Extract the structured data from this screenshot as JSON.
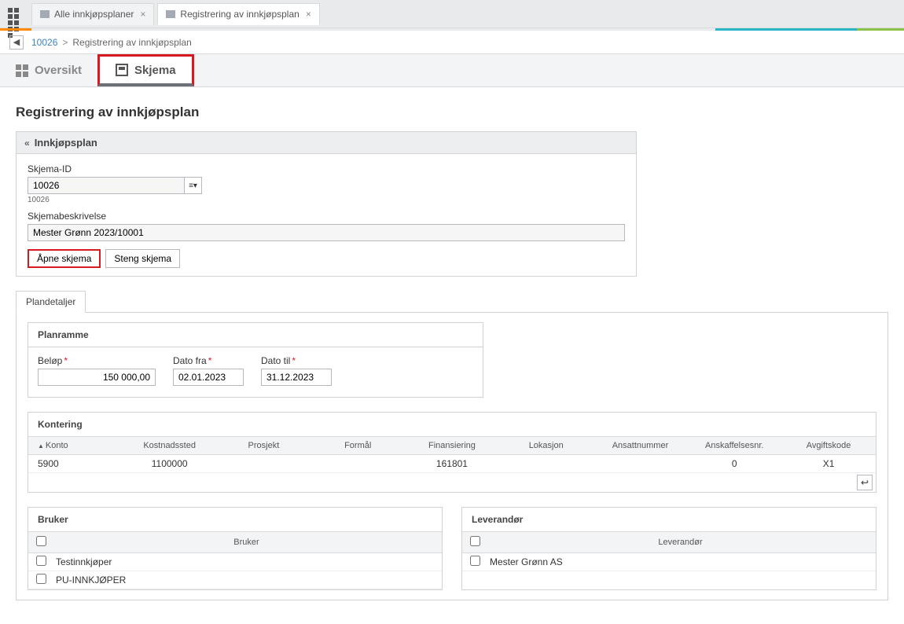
{
  "tabs": [
    {
      "label": "Alle innkjøpsplaner",
      "active": false
    },
    {
      "label": "Registrering av innkjøpsplan",
      "active": true
    }
  ],
  "breadcrumb": {
    "link": "10026",
    "sep": ">",
    "current": "Registrering av innkjøpsplan"
  },
  "view_tabs": {
    "overview": "Oversikt",
    "schema": "Skjema"
  },
  "page_title": "Registrering av innkjøpsplan",
  "panel": {
    "title": "Innkjøpsplan",
    "skjema_id_label": "Skjema-ID",
    "skjema_id_value": "10026",
    "skjema_id_hint": "10026",
    "desc_label": "Skjemabeskrivelse",
    "desc_value": "Mester Grønn 2023/10001",
    "open_btn": "Åpne skjema",
    "close_btn": "Steng skjema"
  },
  "subtab": "Plandetaljer",
  "planramme": {
    "title": "Planramme",
    "amount_label": "Beløp",
    "amount_value": "150 000,00",
    "from_label": "Dato fra",
    "from_value": "02.01.2023",
    "to_label": "Dato til",
    "to_value": "31.12.2023"
  },
  "kontering": {
    "title": "Kontering",
    "columns": [
      "Konto",
      "Kostnadssted",
      "Prosjekt",
      "Formål",
      "Finansiering",
      "Lokasjon",
      "Ansattnummer",
      "Anskaffelsesnr.",
      "Avgiftskode"
    ],
    "row": {
      "konto": "5900",
      "kostnadssted": "1100000",
      "prosjekt": "",
      "formaal": "",
      "finansiering": "161801",
      "lokasjon": "",
      "ansattnummer": "",
      "anskaffelsesnr": "0",
      "avgiftskode": "X1"
    }
  },
  "bruker": {
    "title": "Bruker",
    "column": "Bruker",
    "rows": [
      "Testinnkjøper",
      "PU-INNKJØPER"
    ]
  },
  "leverandor": {
    "title": "Leverandør",
    "column": "Leverandør",
    "rows": [
      "Mester Grønn AS"
    ]
  }
}
